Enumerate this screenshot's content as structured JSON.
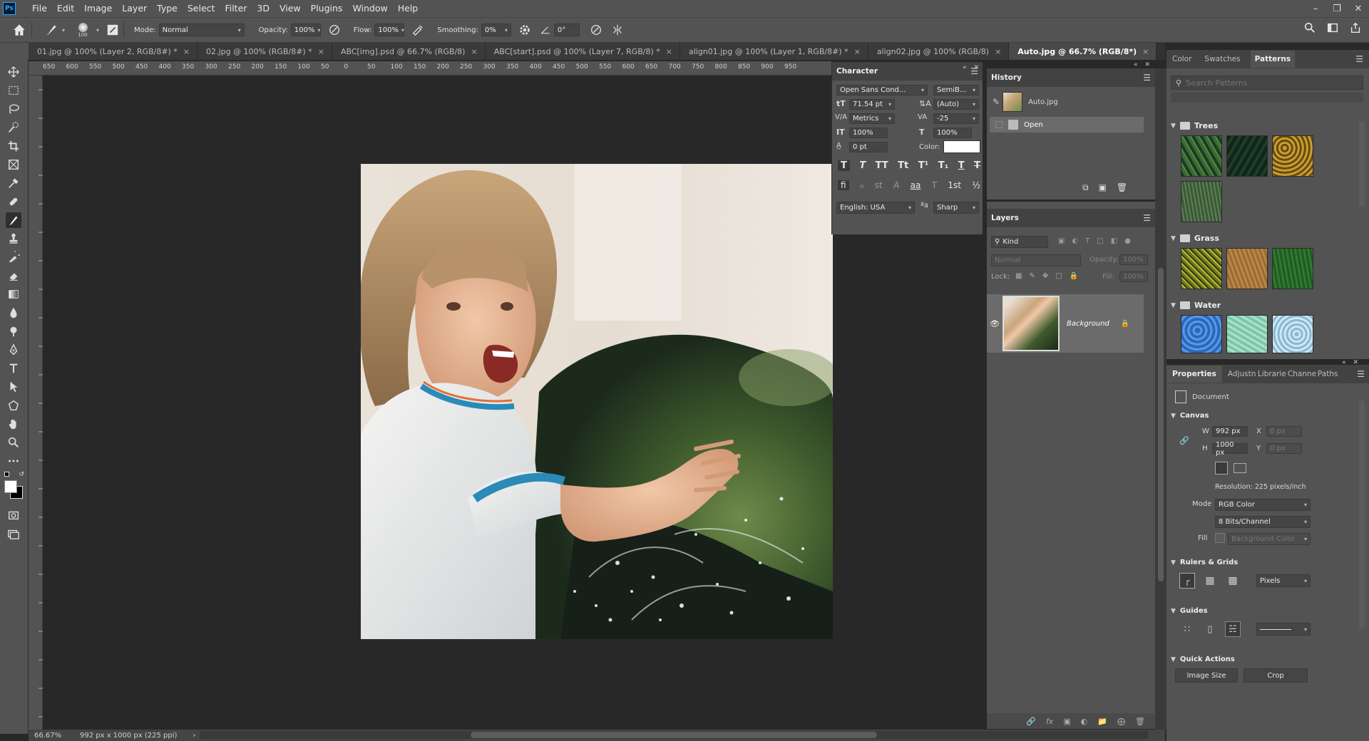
{
  "app": {
    "logo": "Ps"
  },
  "menu": [
    "File",
    "Edit",
    "Image",
    "Layer",
    "Type",
    "Select",
    "Filter",
    "3D",
    "View",
    "Plugins",
    "Window",
    "Help"
  ],
  "window_controls": [
    "minimize",
    "restore",
    "close"
  ],
  "options": {
    "brush_size": "100",
    "mode_label": "Mode:",
    "mode_value": "Normal",
    "opacity_label": "Opacity:",
    "opacity_value": "100%",
    "flow_label": "Flow:",
    "flow_value": "100%",
    "smoothing_label": "Smoothing:",
    "smoothing_value": "0%",
    "angle_value": "0°"
  },
  "tabs": [
    {
      "label": "01.jpg @ 100% (Layer 2, RGB/8#) *"
    },
    {
      "label": "02.jpg @ 100% (RGB/8#) *"
    },
    {
      "label": "ABC[img].psd @ 66.7% (RGB/8)"
    },
    {
      "label": "ABC[start].psd @ 100% (Layer 7, RGB/8) *"
    },
    {
      "label": "align01.jpg @ 100% (Layer 1, RGB/8#) *"
    },
    {
      "label": "align02.jpg @ 100% (RGB/8)"
    },
    {
      "label": "Auto.jpg @ 66.7% (RGB/8*)",
      "active": true
    }
  ],
  "ruler": [
    "650",
    "600",
    "550",
    "500",
    "450",
    "400",
    "350",
    "300",
    "250",
    "200",
    "150",
    "100",
    "50",
    "0",
    "50",
    "100",
    "150",
    "200",
    "250",
    "300",
    "350",
    "400",
    "450",
    "500",
    "550",
    "600",
    "650",
    "700",
    "750",
    "800",
    "850",
    "900",
    "950"
  ],
  "status": {
    "zoom": "66.67%",
    "doc_info": "992 px x 1000 px (225 ppi)",
    "arrow": "›"
  },
  "character": {
    "title": "Character",
    "font_family": "Open Sans Cond...",
    "font_style": "SemiB...",
    "font_size": "71.54 pt",
    "leading": "(Auto)",
    "kerning": "Metrics",
    "tracking": "-25",
    "vert_scale": "100%",
    "horiz_scale": "100%",
    "baseline": "0 pt",
    "color_label": "Color:",
    "style_buttons": [
      "T",
      "T",
      "TT",
      "Tt",
      "T¹",
      "T₁",
      "T",
      "T"
    ],
    "opentype_buttons": [
      "fi",
      "ℴ",
      "st",
      "A",
      "aa",
      "T",
      "1st",
      "½"
    ],
    "language": "English: USA",
    "aa_label": "ªa",
    "antialias": "Sharp"
  },
  "history": {
    "title": "History",
    "snapshot": "Auto.jpg",
    "items": [
      "Open"
    ]
  },
  "layers": {
    "title": "Layers",
    "filter": "Kind",
    "blend": "Normal",
    "opacity_label": "Opacity:",
    "opacity": "100%",
    "lock_label": "Lock:",
    "fill_label": "Fill:",
    "fill": "100%",
    "items": [
      {
        "name": "Background",
        "locked": true
      }
    ]
  },
  "patterns": {
    "tabs": [
      "Color",
      "Swatches",
      "Patterns"
    ],
    "search_placeholder": "Search Patterns",
    "groups": [
      {
        "name": "Trees",
        "swatches": [
          "#2b5a2c",
          "#1c3a26",
          "#9a7a1c",
          "#4a6a48"
        ]
      },
      {
        "name": "Grass",
        "swatches": [
          "#8a8a2a",
          "#9a6a30",
          "#2f6a2f"
        ]
      },
      {
        "name": "Water",
        "swatches": [
          "#3a78c8",
          "#88c8b0",
          "#a8d0e0"
        ]
      }
    ]
  },
  "properties": {
    "tabs": [
      "Properties",
      "Adjustn",
      "Librarie",
      "Channe",
      "Paths"
    ],
    "doc_label": "Document",
    "canvas_title": "Canvas",
    "w_label": "W",
    "w_value": "992 px",
    "h_label": "H",
    "h_value": "1000 px",
    "x_label": "X",
    "x_value": "0 px",
    "y_label": "Y",
    "y_value": "0 px",
    "resolution": "Resolution: 225 pixels/inch",
    "mode_label": "Mode",
    "mode_value": "RGB Color",
    "bits_value": "8 Bits/Channel",
    "fill_label": "Fill",
    "fill_value": "Background Color",
    "rulers_title": "Rulers & Grids",
    "units": "Pixels",
    "guides_title": "Guides",
    "quick_title": "Quick Actions",
    "image_size_btn": "Image Size",
    "crop_btn": "Crop"
  }
}
